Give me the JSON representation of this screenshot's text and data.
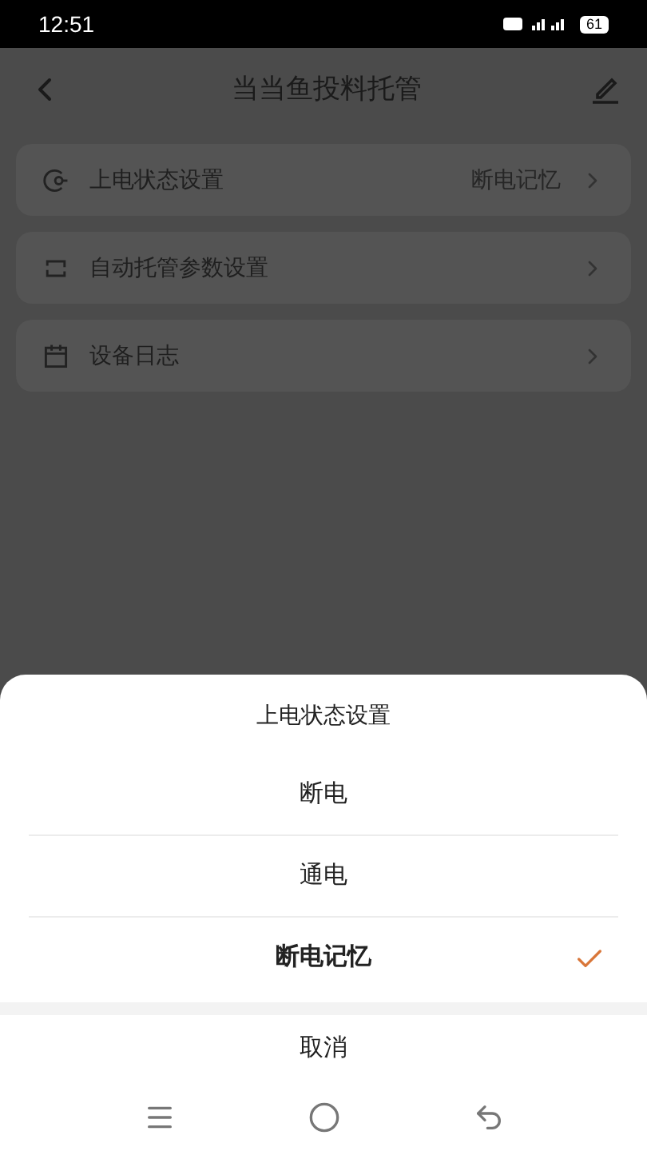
{
  "status_bar": {
    "time": "12:51",
    "battery": "61"
  },
  "header": {
    "title": "当当鱼投料托管"
  },
  "settings": [
    {
      "kind": "power",
      "label": "上电状态设置",
      "value": "断电记忆"
    },
    {
      "kind": "auto",
      "label": "自动托管参数设置"
    },
    {
      "kind": "log",
      "label": "设备日志"
    }
  ],
  "sheet": {
    "title": "上电状态设置",
    "options": [
      {
        "label": "断电",
        "selected": false
      },
      {
        "label": "通电",
        "selected": false
      },
      {
        "label": "断电记忆",
        "selected": true
      }
    ],
    "cancel": "取消"
  }
}
